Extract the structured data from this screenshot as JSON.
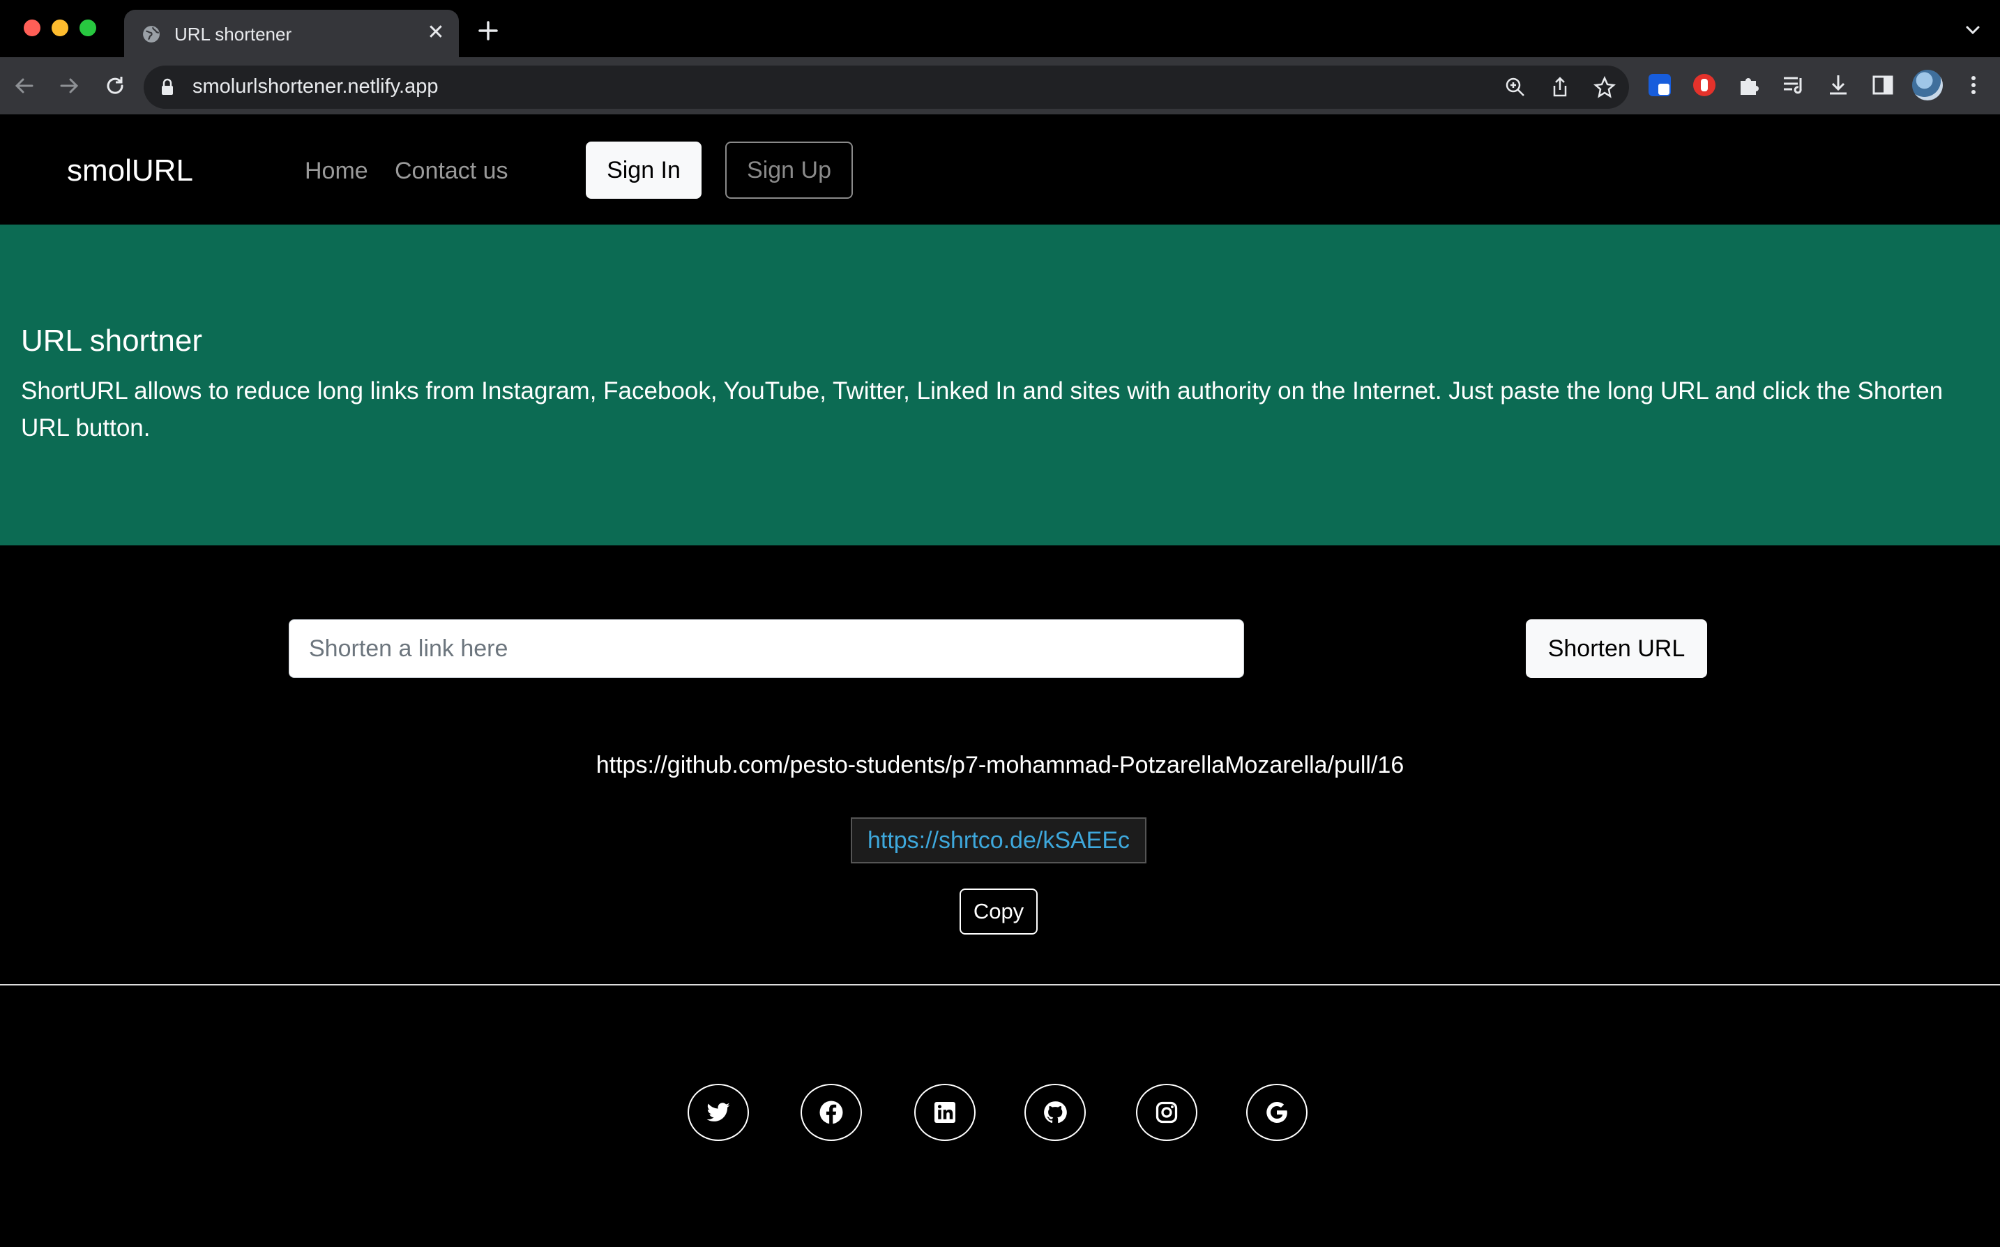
{
  "browser": {
    "tab_title": "URL shortener",
    "address": "smolurlshortener.netlify.app",
    "colors": {
      "tab": "#35363a",
      "toolbar": "#35363a",
      "omnibox": "#202124"
    }
  },
  "nav": {
    "brand": "smolURL",
    "links": [
      "Home",
      "Contact us"
    ],
    "signin_label": "Sign In",
    "signup_label": "Sign Up"
  },
  "hero": {
    "title": "URL shortner",
    "text": "ShortURL allows to reduce long links from Instagram, Facebook, YouTube, Twitter, Linked In and sites with authority on the Internet. Just paste the long URL and click the Shorten URL button.",
    "color": "#0c6b53"
  },
  "form": {
    "input_value": "",
    "input_placeholder": "Shorten a link here",
    "shorten_label": "Shorten URL"
  },
  "result": {
    "long_url": "https://github.com/pesto-students/p7-mohammad-PotzarellaMozarella/pull/16",
    "short_url": "https://shrtco.de/kSAEEc",
    "copy_label": "Copy",
    "link_color": "#3ea8dc"
  },
  "footer": {
    "social_icons": [
      "twitter-icon",
      "facebook-icon",
      "linkedin-icon",
      "github-icon",
      "instagram-icon",
      "google-icon"
    ]
  }
}
